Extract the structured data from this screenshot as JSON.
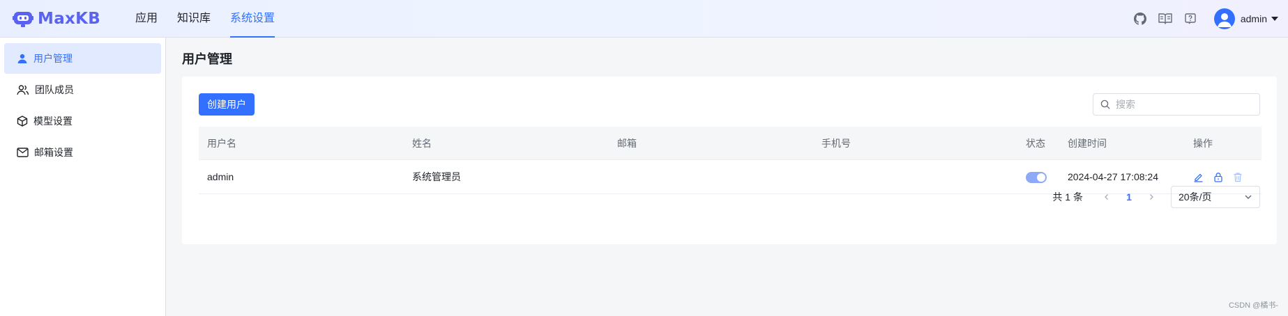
{
  "header": {
    "logo_text": "MaxKB",
    "nav": [
      {
        "label": "应用",
        "active": false
      },
      {
        "label": "知识库",
        "active": false
      },
      {
        "label": "系统设置",
        "active": true
      }
    ],
    "icons": [
      "github-icon",
      "book-icon",
      "help-icon"
    ],
    "username": "admin"
  },
  "sidebar": {
    "items": [
      {
        "label": "用户管理",
        "icon": "user-icon",
        "active": true
      },
      {
        "label": "团队成员",
        "icon": "team-icon",
        "active": false
      },
      {
        "label": "模型设置",
        "icon": "cube-icon",
        "active": false
      },
      {
        "label": "邮箱设置",
        "icon": "mail-icon",
        "active": false
      }
    ]
  },
  "main": {
    "title": "用户管理",
    "create_button": "创建用户",
    "search_placeholder": "搜索",
    "table": {
      "columns": [
        "用户名",
        "姓名",
        "邮箱",
        "手机号",
        "状态",
        "创建时间",
        "操作"
      ],
      "rows": [
        {
          "username": "admin",
          "name": "系统管理员",
          "email": "",
          "phone": "",
          "status_enabled": true,
          "created": "2024-04-27 17:08:24"
        }
      ]
    },
    "pagination": {
      "total_text": "共 1 条",
      "current_page": "1",
      "page_size": "20条/页"
    }
  },
  "colors": {
    "accent": "#3370ff",
    "logo": "#5a63f0"
  },
  "watermark": "CSDN @橘书-"
}
